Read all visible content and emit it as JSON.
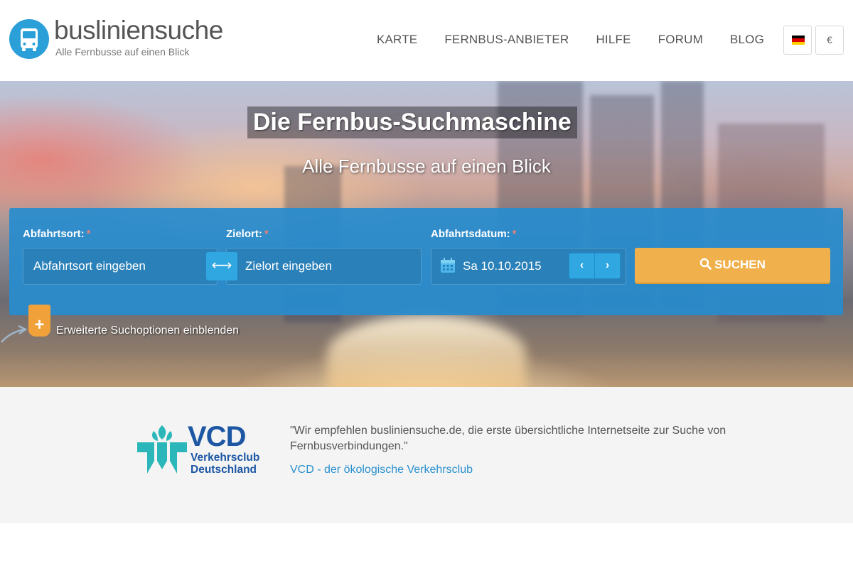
{
  "header": {
    "brand_name": "busliniensuche",
    "brand_slogan": "Alle Fernbusse auf einen Blick",
    "nav": [
      "KARTE",
      "FERNBUS-ANBIETER",
      "HILFE",
      "FORUM",
      "BLOG"
    ],
    "currency_symbol": "€"
  },
  "hero": {
    "title": "Die Fernbus-Suchmaschine",
    "subtitle": "Alle Fernbusse auf einen Blick"
  },
  "search": {
    "from_label": "Abfahrtsort:",
    "to_label": "Zielort:",
    "date_label": "Abfahrtsdatum:",
    "required_mark": "*",
    "from_placeholder": "Abfahrtsort eingeben",
    "to_placeholder": "Zielort eingeben",
    "date_value": "Sa 10.10.2015",
    "swap_symbol": "⟷",
    "prev_symbol": "‹",
    "next_symbol": "›",
    "submit_label": "SUCHEN",
    "advanced_symbol": "+",
    "advanced_label": "Erweiterte Suchoptionen einblenden"
  },
  "testimonial": {
    "org_short": "VCD",
    "org_line1": "Verkehrsclub",
    "org_line2": "Deutschland",
    "quote": "\"Wir empfehlen busliniensuche.de, die erste übersichtliche Internetseite zur Suche von Fernbusverbindungen.\"",
    "link_text": "VCD - der ökologische Verkehrsclub"
  },
  "colors": {
    "brand_blue": "#2a9fd8",
    "panel_blue": "#288ccd",
    "search_orange": "#f0b04c",
    "vcd_blue": "#1d57a4",
    "vcd_teal": "#2bb7b9"
  }
}
